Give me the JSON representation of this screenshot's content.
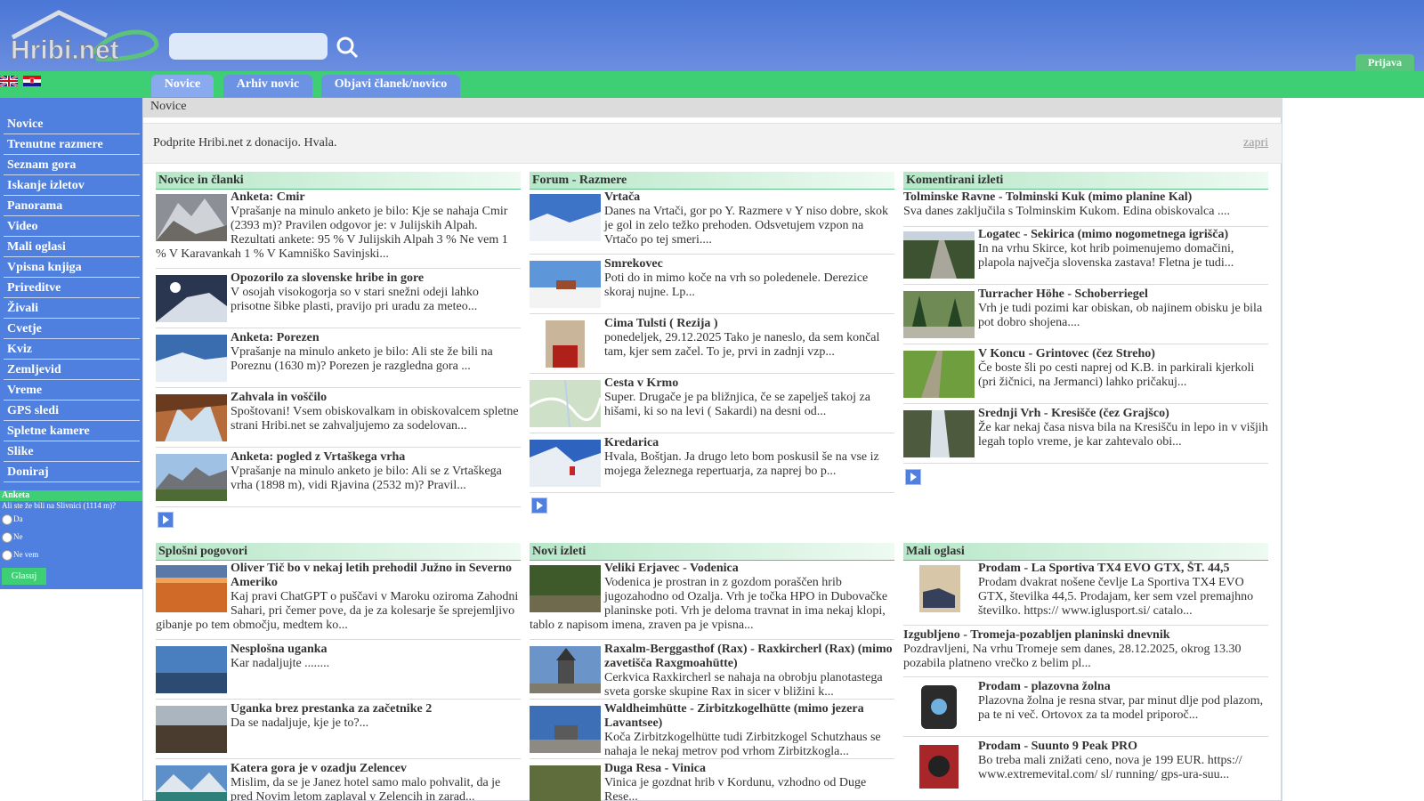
{
  "header": {
    "logo_text": "Hribi.net",
    "search_placeholder": "",
    "login_label": "Prijava",
    "colors": {
      "header_blue": "#4a76d6",
      "accent_green": "#3ecf74"
    }
  },
  "tabs": [
    {
      "label": "Novice",
      "active": true
    },
    {
      "label": "Arhiv novic",
      "active": false
    },
    {
      "label": "Objavi članek/novico",
      "active": false
    }
  ],
  "languages": [
    "english-flag-icon",
    "croatian-flag-icon"
  ],
  "sidebar": {
    "items": [
      "Novice",
      "Trenutne razmere",
      "Seznam gora",
      "Iskanje izletov",
      "Panorama",
      "Video",
      "Mali oglasi",
      "Vpisna knjiga",
      "Prireditve",
      "Živali",
      "Cvetje",
      "Kviz",
      "Zemljevid",
      "Vreme",
      "GPS sledi",
      "Spletne kamere",
      "Slike",
      "Doniraj"
    ],
    "poll": {
      "heading": "Anketa",
      "question": "Ali ste že bili na Slivnici (1114 m)?",
      "options": [
        "Da",
        "Ne",
        "Ne vem"
      ],
      "vote_label": "Glasuj"
    }
  },
  "breadcrumb": "Novice",
  "donation": {
    "text": "Podprite Hribi.net z donacijo. Hvala.",
    "close_label": "zapri"
  },
  "sections": {
    "news": {
      "title": "Novice in članki",
      "items": [
        {
          "title": "Anketa: Cmir",
          "text": "Vprašanje na minulo anketo je bilo: Kje se nahaja Cmir (2393 m)? Pravilen odgovor je: v Julijskih Alpah. Rezultati ankete: 95 % V Julijskih Alpah 3 % Ne vem 1 % V Karavankah 1 % V Kamniško Savinjski..."
        },
        {
          "title": "Opozorilo za slovenske hribe in gore",
          "text": "V osojah visokogorja so v stari snežni odeji lahko prisotne šibke plasti, pravijo pri uradu za meteo..."
        },
        {
          "title": "Anketa: Porezen",
          "text": "Vprašanje na minulo anketo je bilo: Ali ste že bili na Poreznu (1630 m)? Porezen je razgledna gora ..."
        },
        {
          "title": "Zahvala in voščilo",
          "text": "Spoštovani! Vsem obiskovalkam in obiskovalcem spletne strani Hribi.net se zahvaljujemo za sodelovan..."
        },
        {
          "title": "Anketa: pogled z Vrtaškega vrha",
          "text": "Vprašanje na minulo anketo je bilo: Ali se z Vrtaškega vrha (1898 m), vidi Rjavina (2532 m)? Pravil..."
        }
      ]
    },
    "forum": {
      "title": "Forum - Razmere",
      "items": [
        {
          "title": "Vrtača",
          "text": "Danes na Vrtači, gor po Y. Razmere v Y niso dobre, skok je gol in zelo težko prehoden. Odsvetujem vzpon na Vrtačo po tej smeri...."
        },
        {
          "title": "Smrekovec",
          "text": "Poti do in mimo koče na vrh so poledenele. Derezice skoraj nujne. Lp..."
        },
        {
          "title": "Cima Tulsti ( Rezija )",
          "text": "ponedeljek, 29.12.2025 Tako je naneslo, da sem končal tam, kjer sem začel. To je, prvi in zadnji vzp..."
        },
        {
          "title": "Cesta v Krmo",
          "text": "Super. Drugače je pa bližnjica, če se zapelješ takoj za hišami, ki so na levi ( Sakardi) na desni od..."
        },
        {
          "title": "Kredarica",
          "text": "Hvala, Boštjan. Ja drugo leto bom poskusil še na vse iz mojega železnega repertuarja, za naprej bo p..."
        }
      ]
    },
    "comments": {
      "title": "Komentirani izleti",
      "items": [
        {
          "title": "Tolminske Ravne - Tolminski Kuk (mimo planine Kal)",
          "text": "Sva danes zaključila s Tolminskim Kukom. Edina obiskovalca ...."
        },
        {
          "title": "Logatec - Sekirica (mimo nogometnega igrišča)",
          "text": "In na vrhu Skirce, kot hrib poimenujemo domačini, plapola največja slovenska zastava! Fletna je tudi..."
        },
        {
          "title": "Turracher Höhe - Schoberriegel",
          "text": "Vrh je tudi pozimi kar obiskan, ob najinem obisku je bila pot dobro shojena...."
        },
        {
          "title": "V Koncu - Grintovec (čez Streho)",
          "text": "Če boste šli po cesti naprej od K.B. in parkirali kjerkoli (pri žičnici, na Jermanci) lahko pričakuj..."
        },
        {
          "title": "Srednji Vrh - Kresišče (čez Grajšco)",
          "text": "Že kar nekaj časa nisva bila na Kresišču in lepo in v višjih legah toplo vreme, je kar zahtevalo obi..."
        }
      ]
    },
    "general": {
      "title": "Splošni pogovori",
      "items": [
        {
          "title": "Oliver Tič bo v nekaj letih prehodil Južno in Severno Ameriko",
          "text": "Kaj pravi ChatGPT o puščavi v Maroku oziroma Zahodni Sahari, pri čemer pove, da je za kolesarje še sprejemljivo gibanje po tem območju, medtem ko..."
        },
        {
          "title": "Nesplošna uganka",
          "text": "Kar nadaljujte ........"
        },
        {
          "title": "Uganka brez prestanka za začetnike 2",
          "text": "Da se nadaljuje, kje je to?..."
        },
        {
          "title": "Katera gora je v ozadju Zelencev",
          "text": "Mislim, da se je Janez hotel samo malo pohvalit, da je pred Novim letom zaplaval v Zelencih in zarad..."
        }
      ]
    },
    "trips": {
      "title": "Novi izleti",
      "items": [
        {
          "title": "Veliki Erjavec - Vodenica",
          "text": "Vodenica je prostran in z gozdom poraščen hrib jugozahodno od Ozalja. Vrh je točka HPO in Dubovačke planinske poti. Vrh je deloma travnat in ima nekaj klopi, tablo z napisom imena, zraven pa je vpisna..."
        },
        {
          "title": "Raxalm-Berggasthof (Rax) - Raxkircherl (Rax) (mimo zavetišča Raxgmoahütte)",
          "text": "Cerkvica Raxkircherl se nahaja na obrobju planotastega sveta gorske skupine Rax in sicer v bližini k..."
        },
        {
          "title": "Waldheimhütte - Zirbitzkogelhütte (mimo jezera Lavantsee)",
          "text": "Koča Zirbitzkogelhütte tudi Zirbitzkogel Schutzhaus se nahaja le nekaj metrov pod vrhom Zirbitzkogla..."
        },
        {
          "title": "Duga Resa - Vinica",
          "text": "Vinica je gozdnat hrib v Kordunu, vzhodno od Duge Rese..."
        }
      ]
    },
    "ads": {
      "title": "Mali oglasi",
      "items": [
        {
          "title": "Prodam - La Sportiva TX4 EVO GTX, ŠT. 44,5",
          "text": "Prodam dvakrat nošene čevlje La Sportiva TX4 EVO GTX, številka 44,5. Prodajam, ker sem vzel premajhno številko. https:// www.iglusport.si/ catalo..."
        },
        {
          "title": "Izgubljeno - Tromeja-pozabljen planinski dnevnik",
          "text": "Pozdravljeni, Na vrhu Tromeje sem danes, 28.12.2025, okrog 13.30 pozabila platneno vrečko z belim pl..."
        },
        {
          "title": "Prodam - plazovna žolna",
          "text": "Plazovna žolna je resna stvar, par minut dlje pod plazom, pa te ni več. Ortovox za ta model priporoč..."
        },
        {
          "title": "Prodam - Suunto 9 Peak PRO",
          "text": "Bo treba mali znižati ceno, nova je 199 EUR. https:// www.extremevital.com/ sl/ running/ gps-ura-suu..."
        }
      ]
    }
  }
}
